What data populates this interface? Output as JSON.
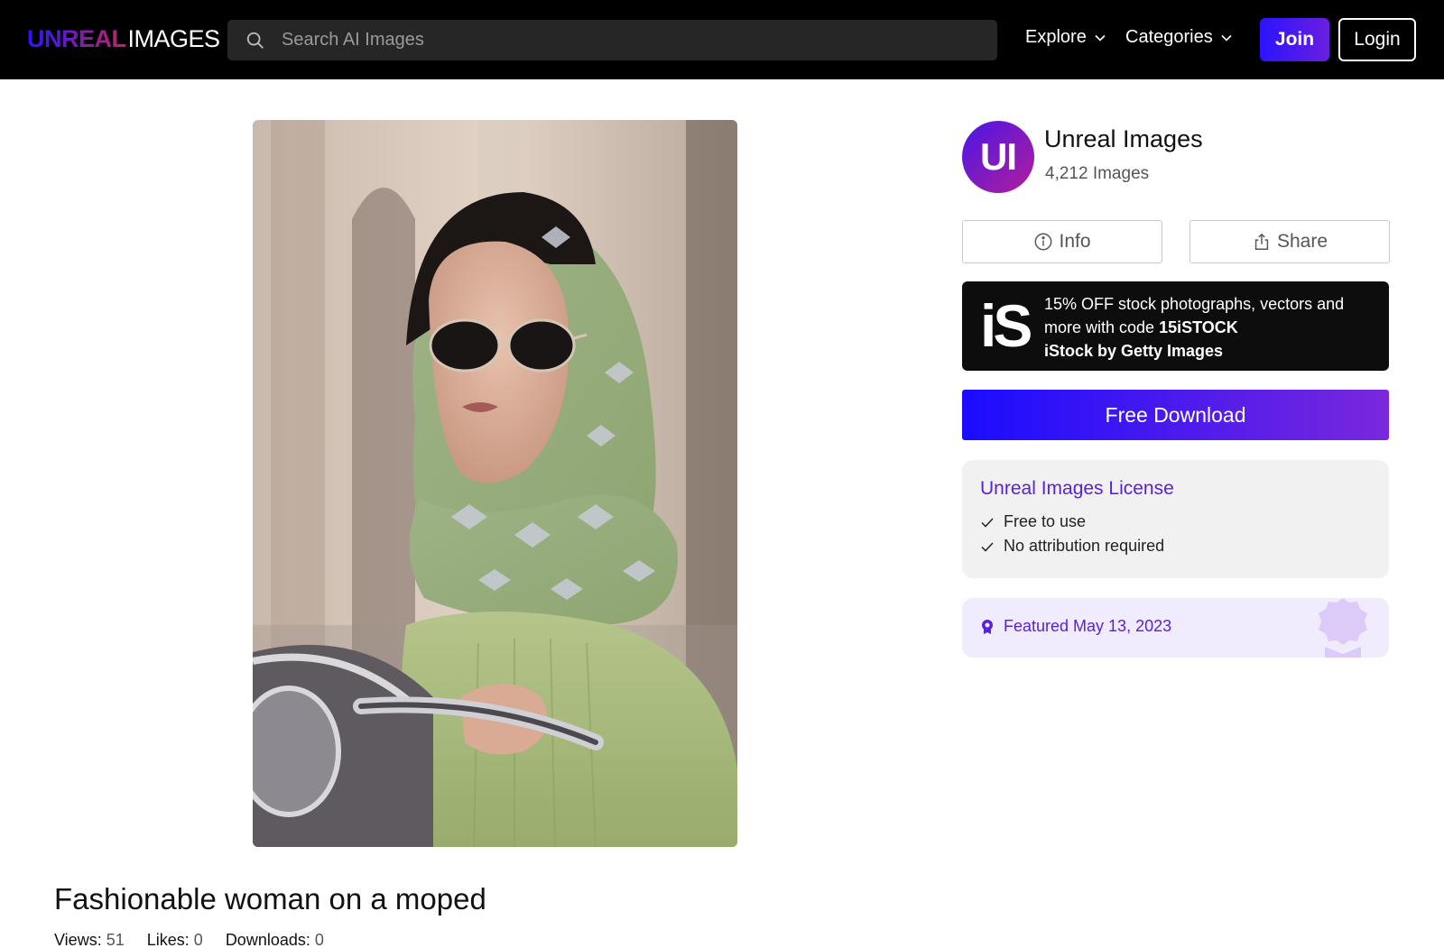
{
  "header": {
    "logo": {
      "part1": "UNREAL",
      "part2": "IMAGES"
    },
    "search": {
      "placeholder": "Search AI Images"
    },
    "nav": {
      "explore": "Explore",
      "categories": "Categories"
    },
    "join": "Join",
    "login": "Login"
  },
  "image": {
    "title": "Fashionable woman on a moped",
    "stats": {
      "views_label": "Views:",
      "views": "51",
      "likes_label": "Likes:",
      "likes": "0",
      "downloads_label": "Downloads:",
      "downloads": "0"
    }
  },
  "author": {
    "initials": "UI",
    "name": "Unreal Images",
    "count": "4,212 Images"
  },
  "actions": {
    "info": "Info",
    "share": "Share"
  },
  "promo": {
    "logo": "iS",
    "line1": "15% OFF stock photographs, vectors and",
    "line2_prefix": "more with code",
    "code": "15iSTOCK",
    "brand": "iStock by Getty Images"
  },
  "download": "Free Download",
  "license": {
    "title": "Unreal Images License",
    "items": [
      "Free to use",
      "No attribution required"
    ]
  },
  "featured": "Featured May 13, 2023",
  "colors": {
    "accent": "#5b21d8",
    "join_gradient": [
      "#2b14ff",
      "#6a1ee0"
    ],
    "download_gradient": [
      "#1a0cff",
      "#7a28dc"
    ],
    "header_bg": "#000000"
  }
}
